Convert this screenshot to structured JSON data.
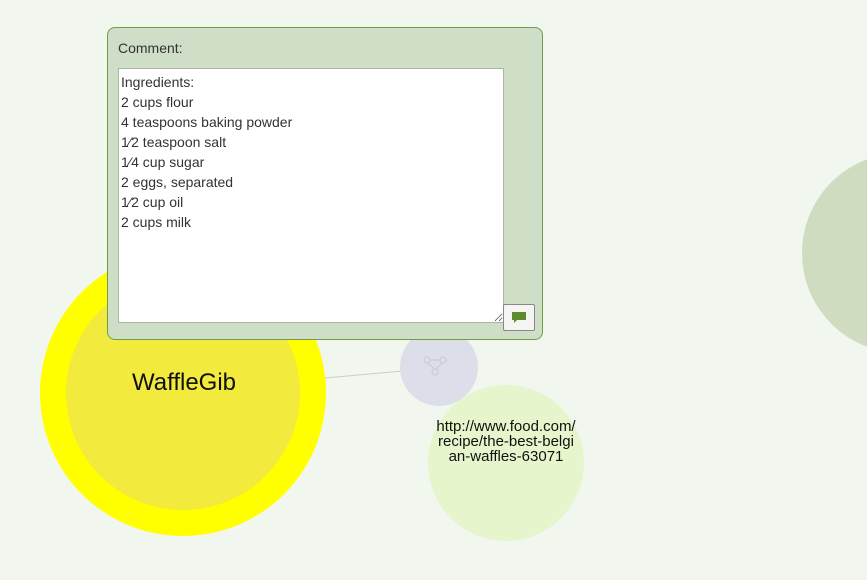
{
  "canvas": {
    "background": "#f1f6ef",
    "nodes": [
      {
        "id": "wafflegib",
        "label": "WaffleGib",
        "color": "#f2ea3c",
        "ring_color": "#ffff00"
      },
      {
        "id": "url-node",
        "label": "http://www.food.com/recipe/the-best-belgian-waffles-63071",
        "color": "#e6f5cc"
      },
      {
        "id": "hub-node",
        "color": "#dcdfea",
        "icon": "hub-icon"
      },
      {
        "id": "edge-node",
        "color": "#cfdcc0"
      }
    ]
  },
  "comment": {
    "label": "Comment:",
    "text": "Ingredients:\n2 cups flour\n4 teaspoons baking powder\n1⁄2 teaspoon salt\n1⁄4 cup sugar\n2 eggs, separated\n1⁄2 cup oil\n2 cups milk",
    "panel_color": "#cfdec7",
    "border_color": "#6f9e46",
    "button_icon": "speech-bubble-icon",
    "button_icon_color": "#5f8a2e"
  }
}
